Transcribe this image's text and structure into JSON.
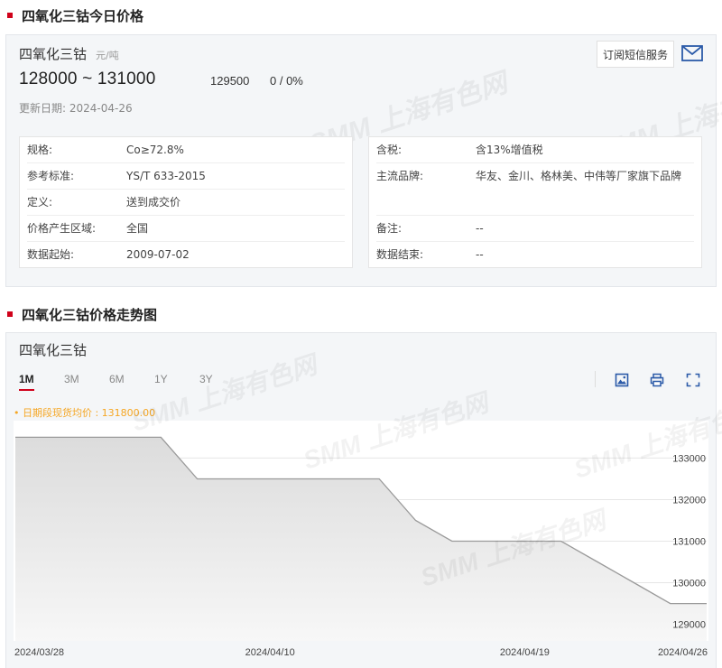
{
  "section1": {
    "title": "四氧化三钴今日价格"
  },
  "product": {
    "name": "四氧化三钴",
    "unit": "元/吨",
    "price_range": "128000 ~ 131000",
    "avg_price": "129500",
    "change": "0 / 0%",
    "update_label": "更新日期:",
    "update_date": "2024-04-26"
  },
  "sms_button": "订阅短信服务",
  "specs_left": [
    {
      "k": "规格:",
      "v": "Co≥72.8%"
    },
    {
      "k": "参考标准:",
      "v": "YS/T 633-2015"
    },
    {
      "k": "定义:",
      "v": "送到成交价"
    },
    {
      "k": "价格产生区域:",
      "v": "全国"
    },
    {
      "k": "数据起始:",
      "v": "2009-07-02"
    }
  ],
  "specs_right": [
    {
      "k": "含税:",
      "v": "含13%增值税"
    },
    {
      "k": "主流品牌:",
      "v": "华友、金川、格林美、中伟等厂家旗下品牌"
    },
    {
      "k": "备注:",
      "v": "--"
    },
    {
      "k": "数据结束:",
      "v": "--"
    }
  ],
  "section2": {
    "title": "四氧化三钴价格走势图"
  },
  "chart_panel": {
    "title": "四氧化三钴",
    "tabs": [
      "1M",
      "3M",
      "6M",
      "1Y",
      "3Y"
    ],
    "active_tab": "1M",
    "legend_note": "• 日期段现货均价 : 131800.00"
  },
  "watermark": "SMM 上海有色网",
  "colors": {
    "accent": "#d0021b",
    "note": "#f5a623",
    "line": "#9a9a9a"
  },
  "chart_data": {
    "type": "area",
    "x": [
      "2024/03/28",
      "2024/03/29",
      "2024/04/01",
      "2024/04/02",
      "2024/04/03",
      "2024/04/08",
      "2024/04/09",
      "2024/04/10",
      "2024/04/11",
      "2024/04/12",
      "2024/04/15",
      "2024/04/16",
      "2024/04/17",
      "2024/04/18",
      "2024/04/19",
      "2024/04/22",
      "2024/04/23",
      "2024/04/24",
      "2024/04/25",
      "2024/04/26"
    ],
    "series": [
      {
        "values": [
          133500,
          133500,
          133500,
          133500,
          133500,
          132500,
          132500,
          132500,
          132500,
          132500,
          132500,
          131500,
          131000,
          131000,
          131000,
          131000,
          130500,
          130000,
          129500,
          129500
        ]
      }
    ],
    "x_tick_labels": [
      "2024/03/28",
      "2024/04/10",
      "2024/04/19",
      "2024/04/26"
    ],
    "y_ticks": [
      129000,
      130000,
      131000,
      132000,
      133000
    ],
    "ylim": [
      128600,
      133900
    ],
    "grid": true
  }
}
